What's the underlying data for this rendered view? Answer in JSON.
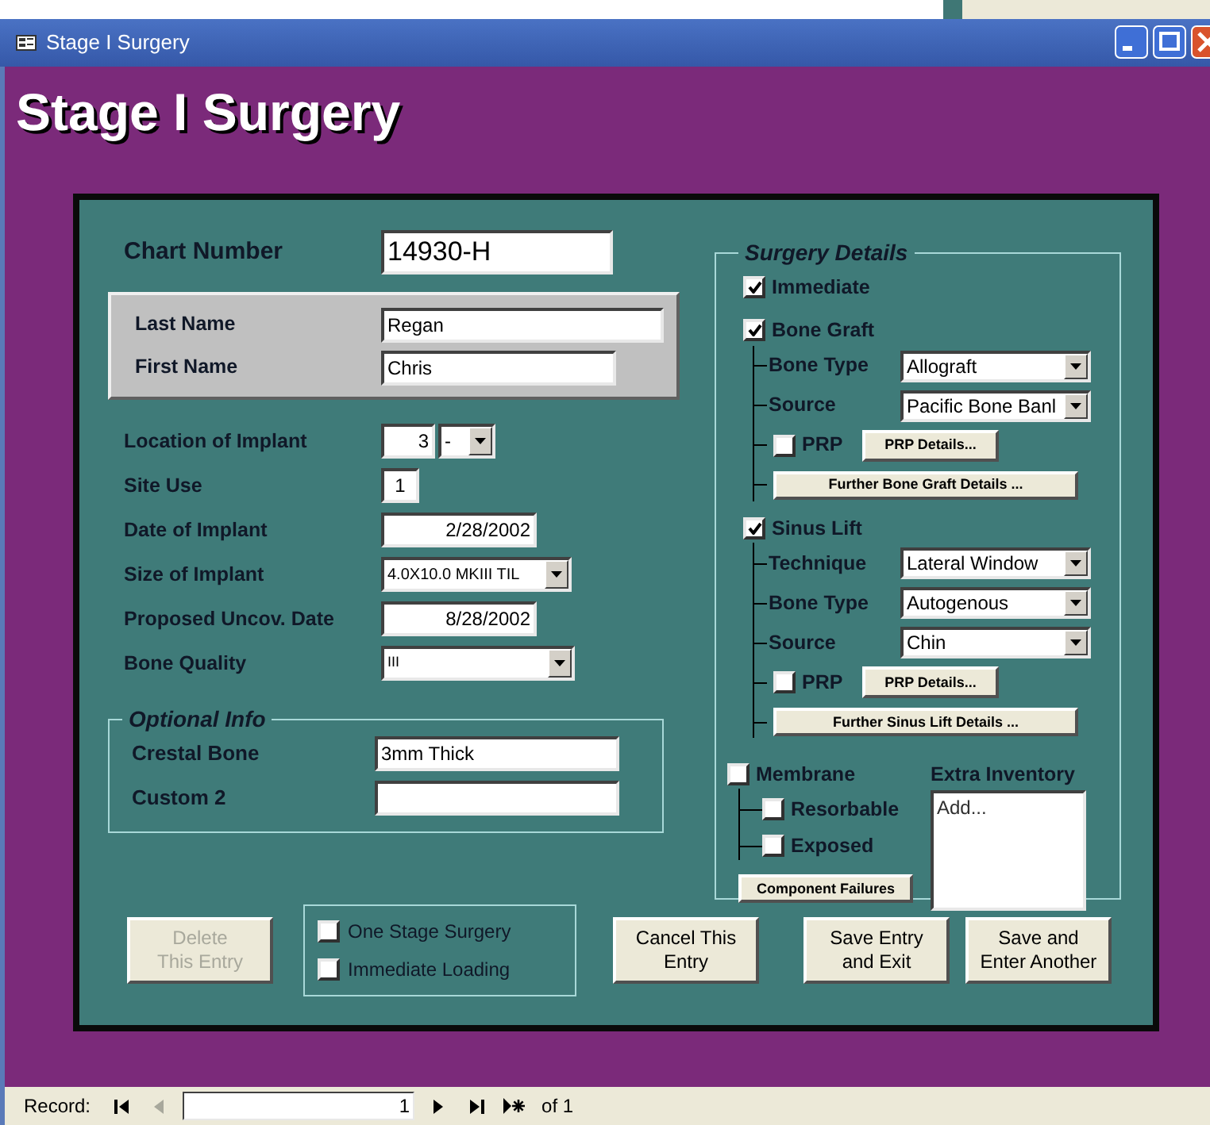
{
  "window": {
    "title": "Stage I Surgery"
  },
  "form_title": "Stage I Surgery",
  "chart_number": {
    "label": "Chart Number",
    "value": "14930-H"
  },
  "name_fields": [
    {
      "label": "Last Name",
      "value": "Regan"
    },
    {
      "label": "First Name",
      "value": "Chris"
    }
  ],
  "fields": [
    {
      "kind": "pair",
      "label": "Location of Implant",
      "value": "3",
      "value_2": "-"
    },
    {
      "kind": "number",
      "label": "Site Use",
      "value": "1"
    },
    {
      "kind": "date",
      "label": "Date of Implant",
      "value": "2/28/2002"
    },
    {
      "kind": "combo",
      "label": "Size of Implant",
      "value": "4.0X10.0 MKIII TIL"
    },
    {
      "kind": "date",
      "label": "Proposed Uncov. Date",
      "value": "8/28/2002"
    },
    {
      "kind": "combo",
      "label": "Bone Quality",
      "value": "III"
    }
  ],
  "optional_info": {
    "title": "Optional Info",
    "fields": [
      {
        "label": "Crestal Bone",
        "value": "3mm Thick"
      },
      {
        "label": "Custom 2"
      }
    ]
  },
  "surgery_details": {
    "title": "Surgery Details",
    "sections": [
      {
        "label": "Immediate",
        "checked": true
      },
      {
        "label": "Bone Graft",
        "checked": true,
        "children": [
          {
            "kind": "combo",
            "label": "Bone Type",
            "value": "Allograft"
          },
          {
            "kind": "combo",
            "label": "Source",
            "value": "Pacific Bone Banl"
          },
          {
            "kind": "prp",
            "label": "PRP",
            "checked": false,
            "button": "PRP Details..."
          },
          {
            "kind": "button",
            "label": "Further Bone Graft Details ..."
          }
        ]
      },
      {
        "label": "Sinus Lift",
        "checked": true,
        "children": [
          {
            "kind": "combo",
            "label": "Technique",
            "value": "Lateral Window"
          },
          {
            "kind": "combo",
            "label": "Bone Type",
            "value": "Autogenous"
          },
          {
            "kind": "combo",
            "label": "Source",
            "value": "Chin"
          },
          {
            "kind": "prp",
            "label": "PRP",
            "checked": false,
            "button": "PRP Details..."
          },
          {
            "kind": "button",
            "label": "Further Sinus Lift Details ..."
          }
        ]
      }
    ],
    "membrane": {
      "label": "Membrane",
      "checked": false,
      "children": [
        {
          "label": "Resorbable",
          "checked": false
        },
        {
          "label": "Exposed",
          "checked": false
        }
      ]
    },
    "component_button": "Component Failures",
    "inventory": {
      "label": "Extra Inventory",
      "items": [
        "Add..."
      ]
    }
  },
  "delete_button": {
    "label": "Delete\nThis Entry",
    "disabled": true
  },
  "options": [
    {
      "label": "One Stage Surgery",
      "checked": false
    },
    {
      "label": "Immediate Loading",
      "checked": false
    }
  ],
  "buttons": [
    "Cancel This\nEntry",
    "Save Entry\nand Exit",
    "Save and\nEnter Another"
  ],
  "status_bar": {
    "label": "Record:",
    "current": "1",
    "total": "of 1"
  }
}
